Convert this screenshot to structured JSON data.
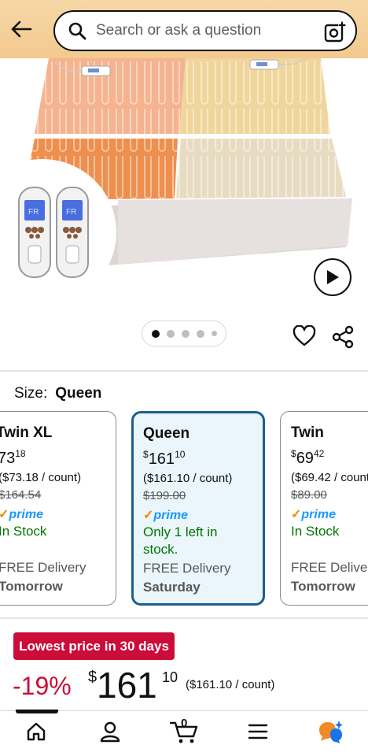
{
  "header": {
    "search_placeholder": "Search or ask a question"
  },
  "gallery": {
    "image_count": 5,
    "active_index": 0
  },
  "size": {
    "label": "Size:",
    "value": "Queen"
  },
  "variants": [
    {
      "name": "Twin XL",
      "price_whole": "73",
      "price_fraction": "18",
      "unit_price": "($73.18 / count)",
      "list_price": "$164.54",
      "prime": "prime",
      "stock": "In Stock",
      "delivery": "FREE Delivery",
      "day": "Tomorrow"
    },
    {
      "name": "Queen",
      "price_symbol": "$",
      "price_whole": "161",
      "price_fraction": "10",
      "unit_price": "($161.10 / count)",
      "list_price": "$199.00",
      "prime": "prime",
      "stock_line1": "Only 1 left in",
      "stock_line2": "stock.",
      "delivery": "FREE Delivery",
      "day": "Saturday"
    },
    {
      "name": "Twin",
      "price_symbol": "$",
      "price_whole": "69",
      "price_fraction": "42",
      "unit_price": "($69.42 / count)",
      "list_price": "$89.00",
      "prime": "prime",
      "stock": "In Stock",
      "delivery": "FREE Delivery",
      "day": "Tomorrow"
    }
  ],
  "deal": {
    "badge": "Lowest price in 30 days",
    "discount": "-19%",
    "currency": "$",
    "price_whole": "161",
    "price_fraction": "10",
    "unit_price": "($161.10 / count)"
  },
  "cart": {
    "count": "0"
  },
  "colors": {
    "accent_blue": "#1f5e8d",
    "prime_blue": "#1a98ff",
    "deal_red": "#cc0c39",
    "stock_green": "#007600",
    "header_bg": "#f3c98f"
  }
}
